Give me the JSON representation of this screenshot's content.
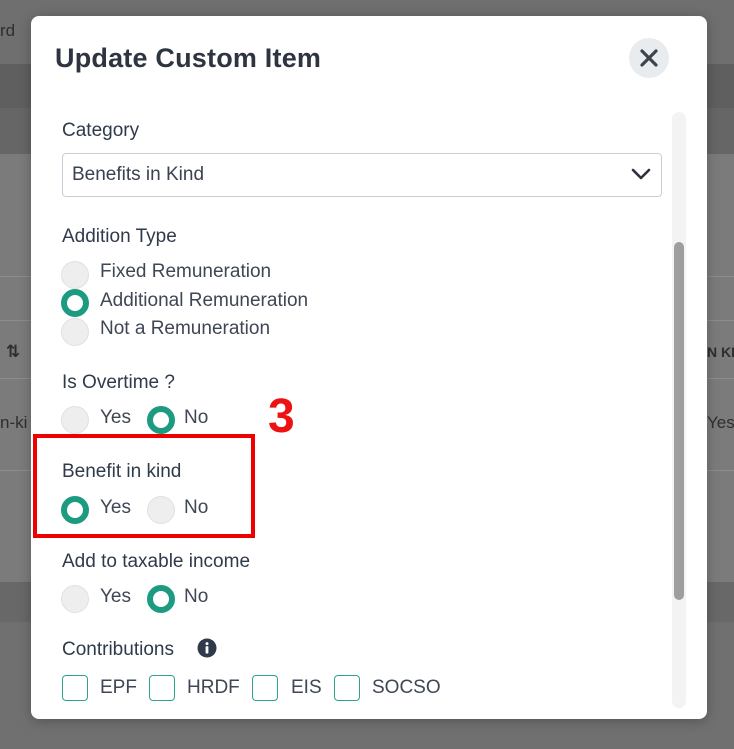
{
  "background": {
    "top_left_fragment": "rd",
    "left_fragment": "n-ki",
    "right_fragment": "Yes",
    "right_header_fragment": "N KI",
    "sort_icon": "sort-arrows-icon"
  },
  "modal": {
    "title": "Update Custom Item",
    "close_icon": "close-icon"
  },
  "category": {
    "label": "Category",
    "value": "Benefits in Kind",
    "icon": "chevron-down-icon"
  },
  "addition_type": {
    "label": "Addition Type",
    "options": [
      {
        "label": "Fixed Remuneration",
        "selected": false
      },
      {
        "label": "Additional Remuneration",
        "selected": true
      },
      {
        "label": "Not a Remuneration",
        "selected": false
      }
    ]
  },
  "is_overtime": {
    "label": "Is Overtime ?",
    "yes": "Yes",
    "no": "No",
    "selected": "No"
  },
  "benefit_in_kind": {
    "label": "Benefit in kind",
    "yes": "Yes",
    "no": "No",
    "selected": "Yes"
  },
  "taxable_income": {
    "label": "Add to taxable income",
    "yes": "Yes",
    "no": "No",
    "selected": "No"
  },
  "contributions": {
    "label": "Contributions",
    "info_icon": "info-icon",
    "items": [
      {
        "label": "EPF",
        "checked": false
      },
      {
        "label": "HRDF",
        "checked": false
      },
      {
        "label": "EIS",
        "checked": false
      },
      {
        "label": "SOCSO",
        "checked": false
      }
    ]
  },
  "annotation": {
    "step": "3",
    "color": "#ee0000"
  },
  "colors": {
    "accent": "#1d9b80",
    "overlay": "#707070"
  }
}
